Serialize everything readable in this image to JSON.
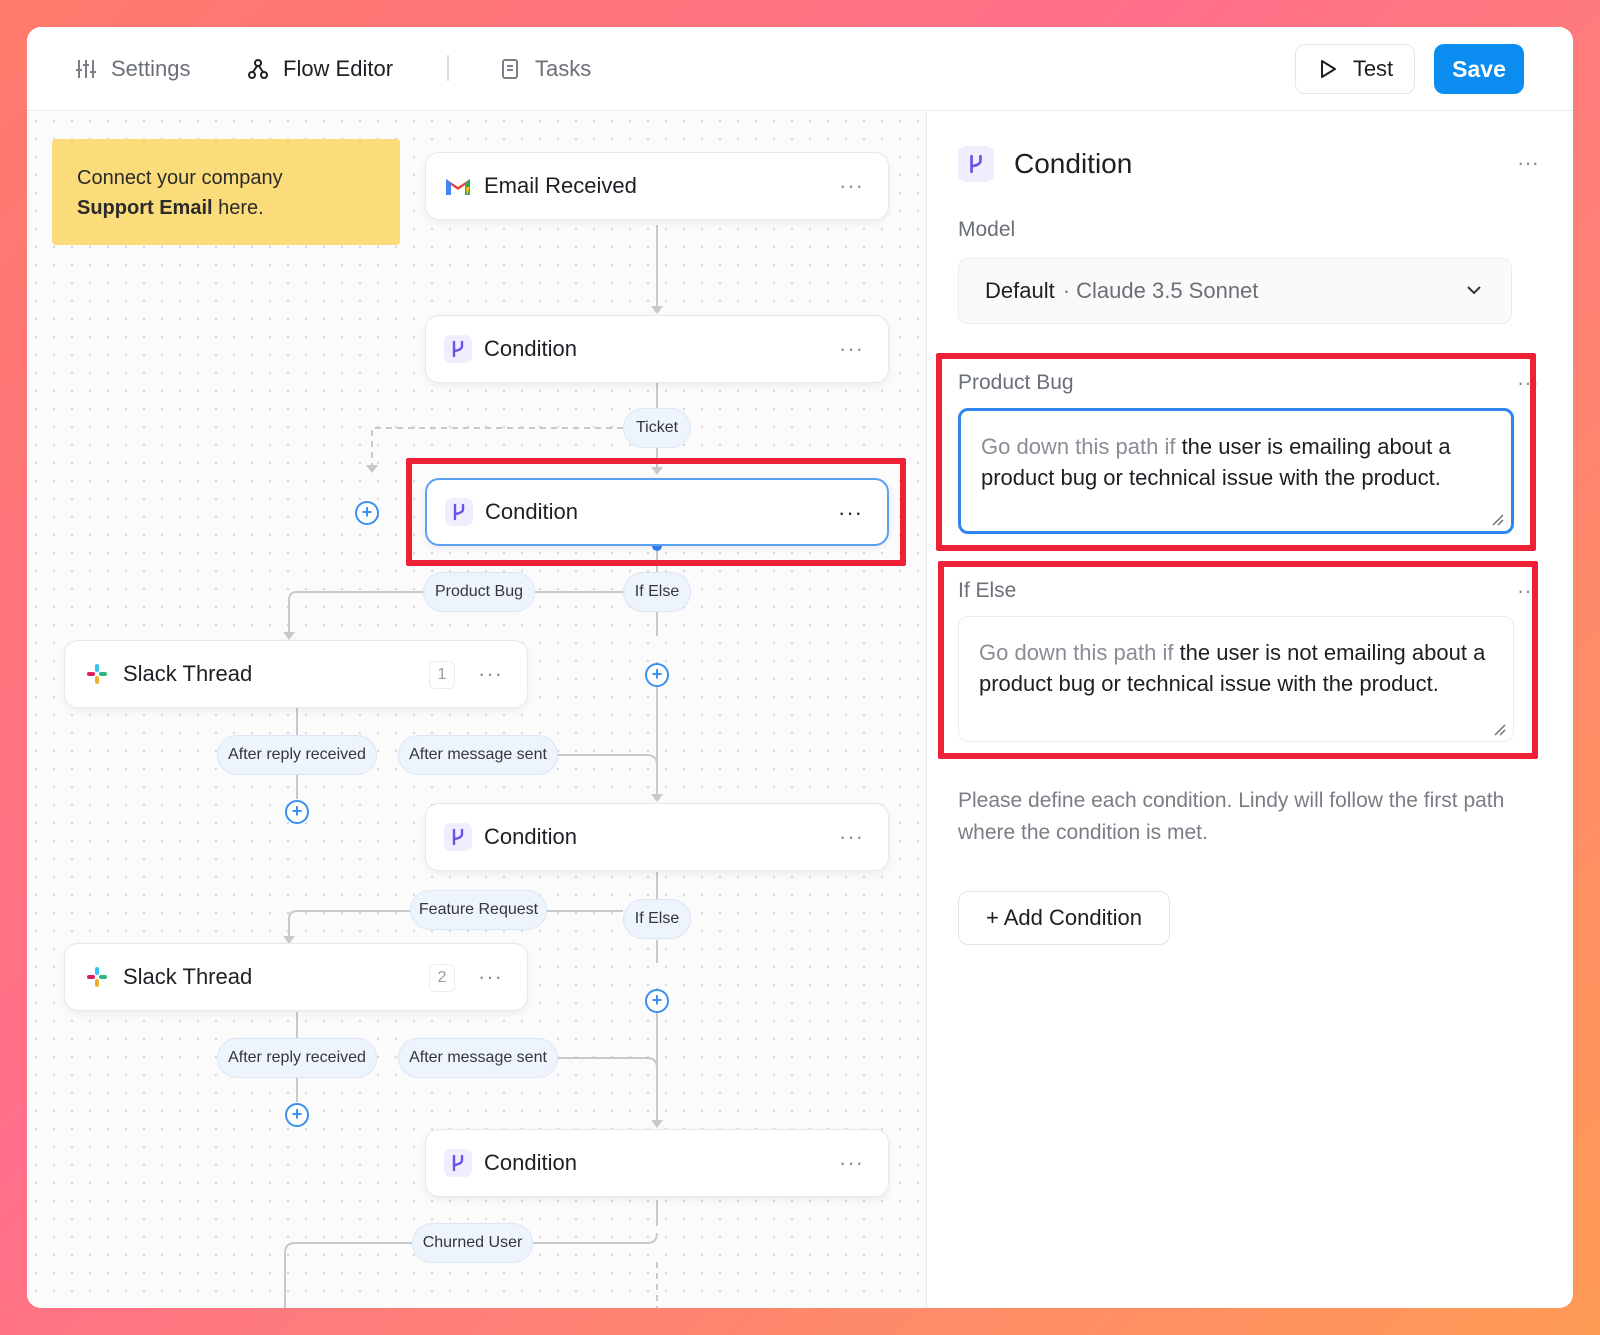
{
  "nav": {
    "tabs": [
      {
        "label": "Settings",
        "icon": "sliders-icon"
      },
      {
        "label": "Flow Editor",
        "icon": "flow-icon"
      },
      {
        "label": "Tasks",
        "icon": "tasks-icon"
      }
    ],
    "test_label": "Test",
    "save_label": "Save"
  },
  "canvas": {
    "note": {
      "line1": "Connect your company",
      "bold": "Support Email",
      "tail": " here."
    },
    "nodes": [
      {
        "label": "Email Received",
        "icon": "gmail-icon"
      },
      {
        "label": "Condition",
        "icon": "branch-icon"
      },
      {
        "label": "Condition",
        "icon": "branch-icon",
        "selected": true
      },
      {
        "label": "Slack Thread",
        "icon": "slack-icon",
        "count": "1"
      },
      {
        "label": "Condition",
        "icon": "branch-icon"
      },
      {
        "label": "Slack Thread",
        "icon": "slack-icon",
        "count": "2"
      },
      {
        "label": "Condition",
        "icon": "branch-icon"
      }
    ],
    "pills": {
      "ticket": "Ticket",
      "product_bug": "Product Bug",
      "if_else_1": "If Else",
      "after_reply_1": "After reply received",
      "after_sent_1": "After message sent",
      "feature_request": "Feature Request",
      "if_else_2": "If Else",
      "after_reply_2": "After reply received",
      "after_sent_2": "After message sent",
      "churned_user": "Churned User"
    },
    "more_glyph": "···",
    "plus_glyph": "+"
  },
  "panel": {
    "title": "Condition",
    "model_label": "Model",
    "model_default": "Default",
    "model_name": "· Claude 3.5 Sonnet",
    "conditions": [
      {
        "name": "Product Bug",
        "prefix": "Go down this path if",
        "text": " the user is emailing about a product bug or technical issue with the product."
      },
      {
        "name": "If Else",
        "prefix": "Go down this path if",
        "text": " the user is not emailing about a product bug or technical issue with the product."
      }
    ],
    "help": "Please define each condition. Lindy will follow the first path where the condition is met.",
    "add_label": "+ Add Condition"
  },
  "colors": {
    "accent": "#0a8cf0",
    "highlight": "#ef2136",
    "note": "#fbdc7a",
    "branch_icon": "#6b52e6"
  }
}
